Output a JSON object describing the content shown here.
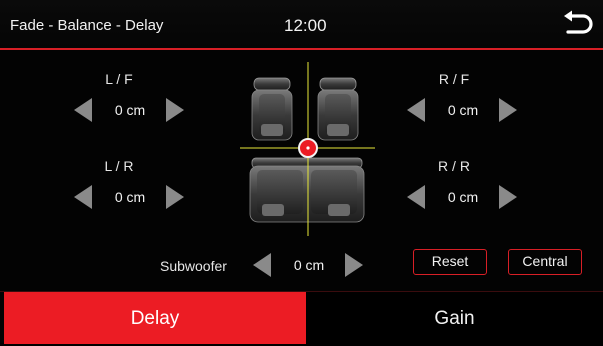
{
  "header": {
    "title": "Fade - Balance - Delay",
    "clock": "12:00",
    "back_icon": "return-arrow-icon"
  },
  "channels": {
    "lf": {
      "label": "L / F",
      "value": "0 cm"
    },
    "rf": {
      "label": "R / F",
      "value": "0 cm"
    },
    "lr": {
      "label": "L / R",
      "value": "0 cm"
    },
    "rr": {
      "label": "R / R",
      "value": "0 cm"
    }
  },
  "subwoofer": {
    "label": "Subwoofer",
    "value": "0 cm"
  },
  "buttons": {
    "reset": "Reset",
    "central": "Central"
  },
  "tabs": [
    {
      "label": "Delay",
      "active": true
    },
    {
      "label": "Gain",
      "active": false
    }
  ],
  "colors": {
    "accent": "#ec1c24",
    "crosshair": "#e8e83a",
    "background": "#030303"
  },
  "icons": {
    "left": "left-triangle-icon",
    "right": "right-triangle-icon",
    "seat": "car-seat-icon",
    "focus": "listening-position-marker-icon"
  }
}
